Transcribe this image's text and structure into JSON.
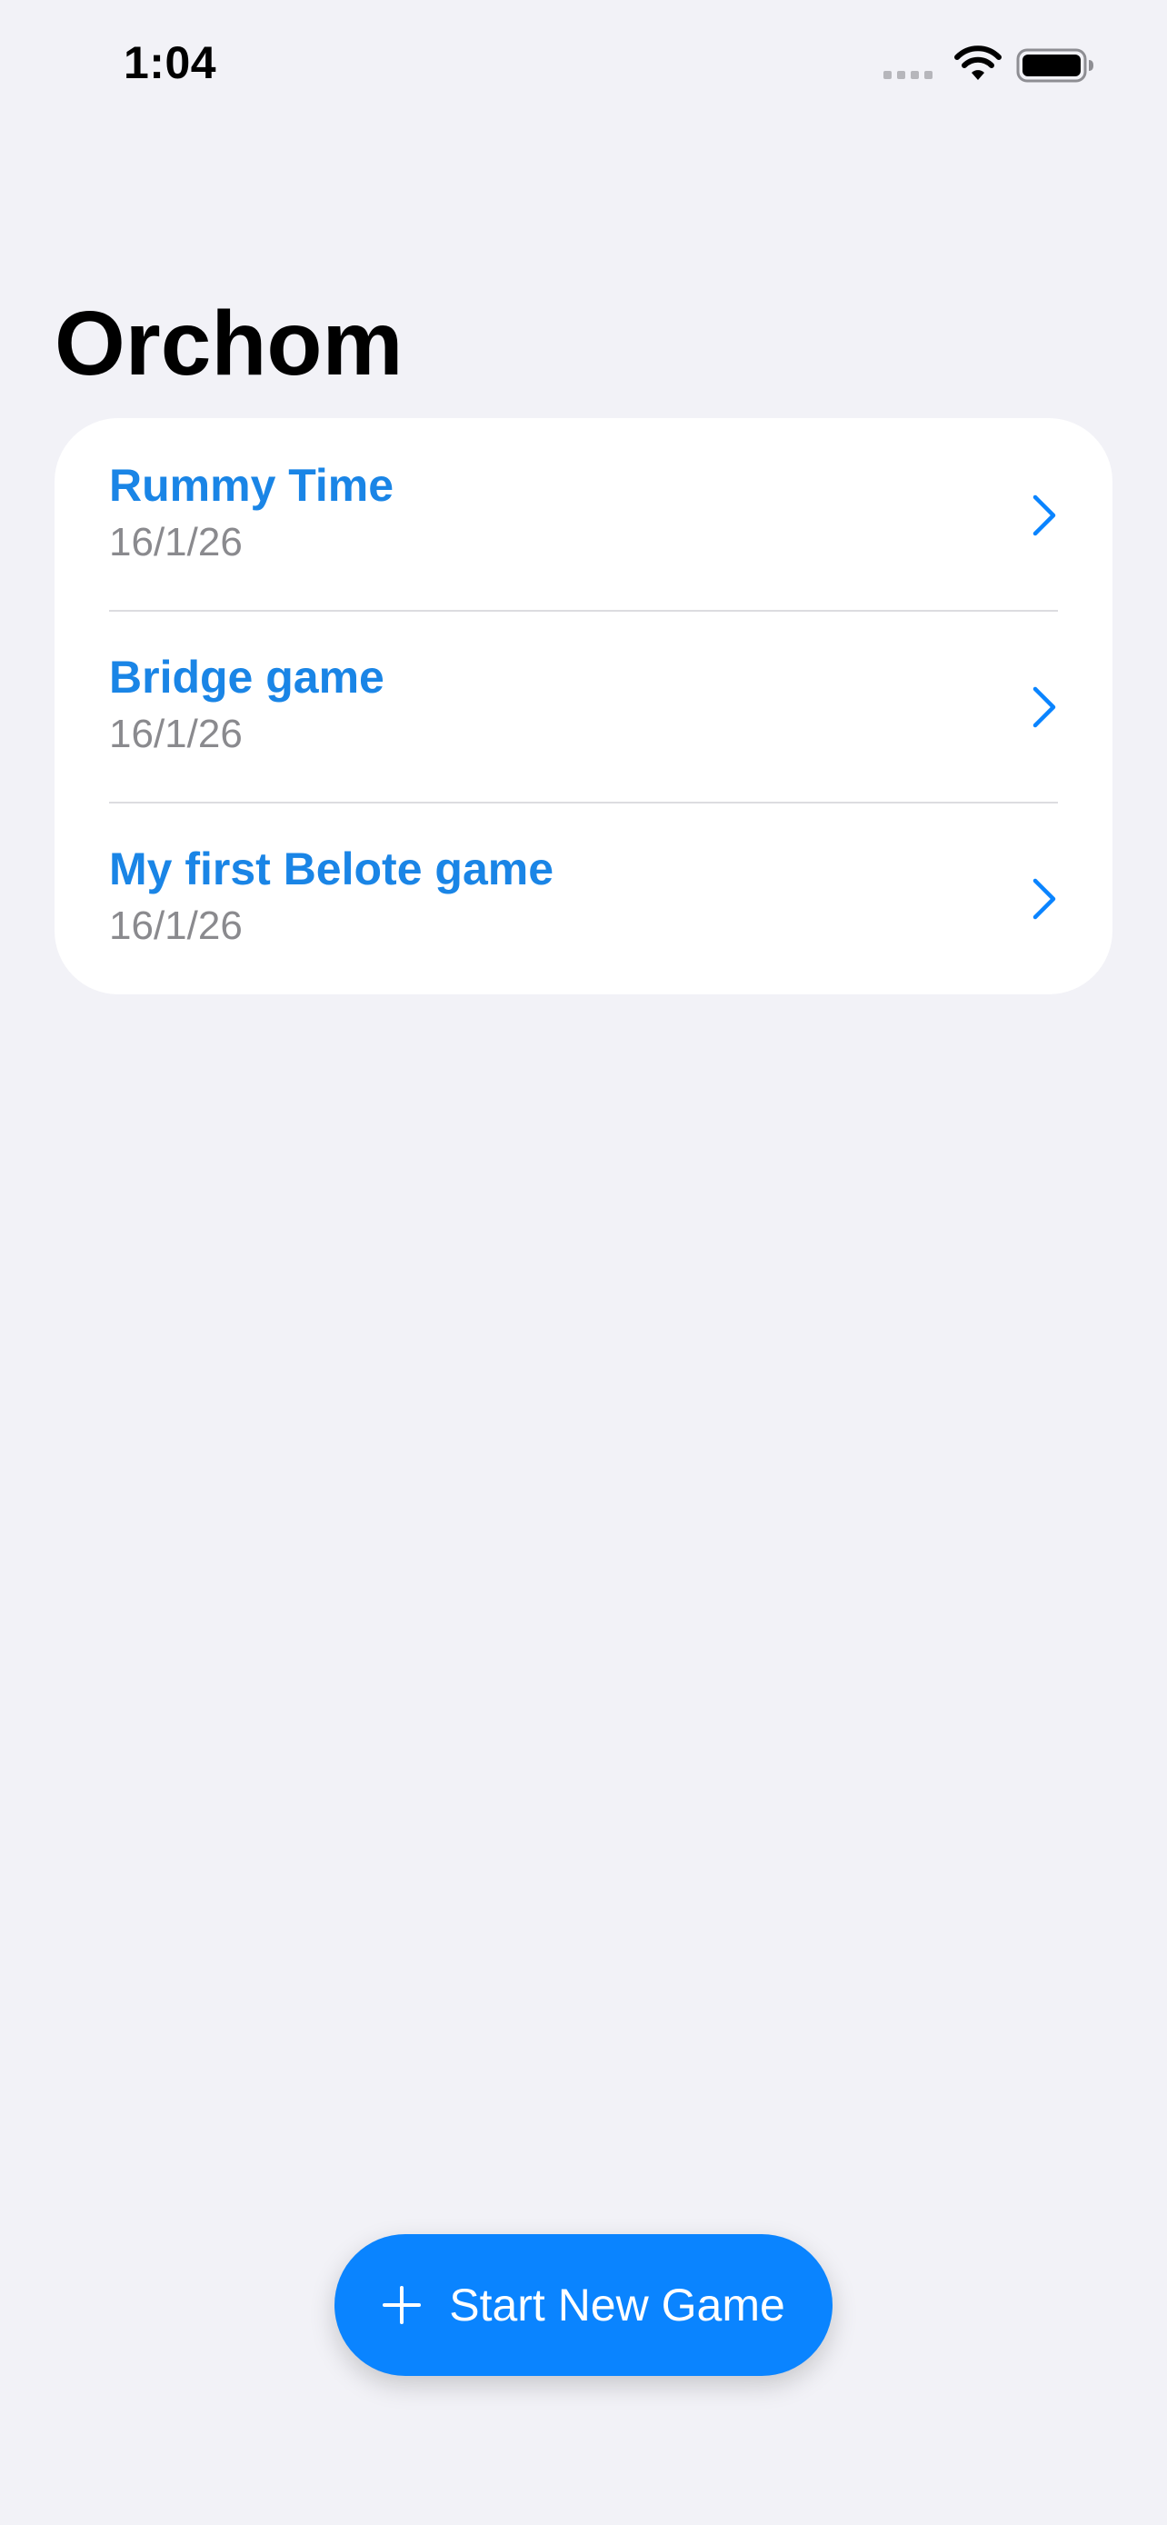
{
  "status_bar": {
    "time": "1:04"
  },
  "header": {
    "title": "Orchom"
  },
  "games": [
    {
      "name": "Rummy Time",
      "date": "16/1/26"
    },
    {
      "name": "Bridge game",
      "date": "16/1/26"
    },
    {
      "name": "My first Belote game",
      "date": "16/1/26"
    }
  ],
  "actions": {
    "new_game_label": "Start New Game",
    "new_game_icon": "plus-icon"
  },
  "colors": {
    "accent": "#0a84ff",
    "link_text": "#1a85e6",
    "background": "#f2f2f7",
    "secondary_text": "#8a8a8e"
  },
  "icons": {
    "row_disclosure": "chevron-right-icon",
    "signal": "cellular-signal-icon",
    "wifi": "wifi-icon",
    "battery": "battery-icon"
  }
}
